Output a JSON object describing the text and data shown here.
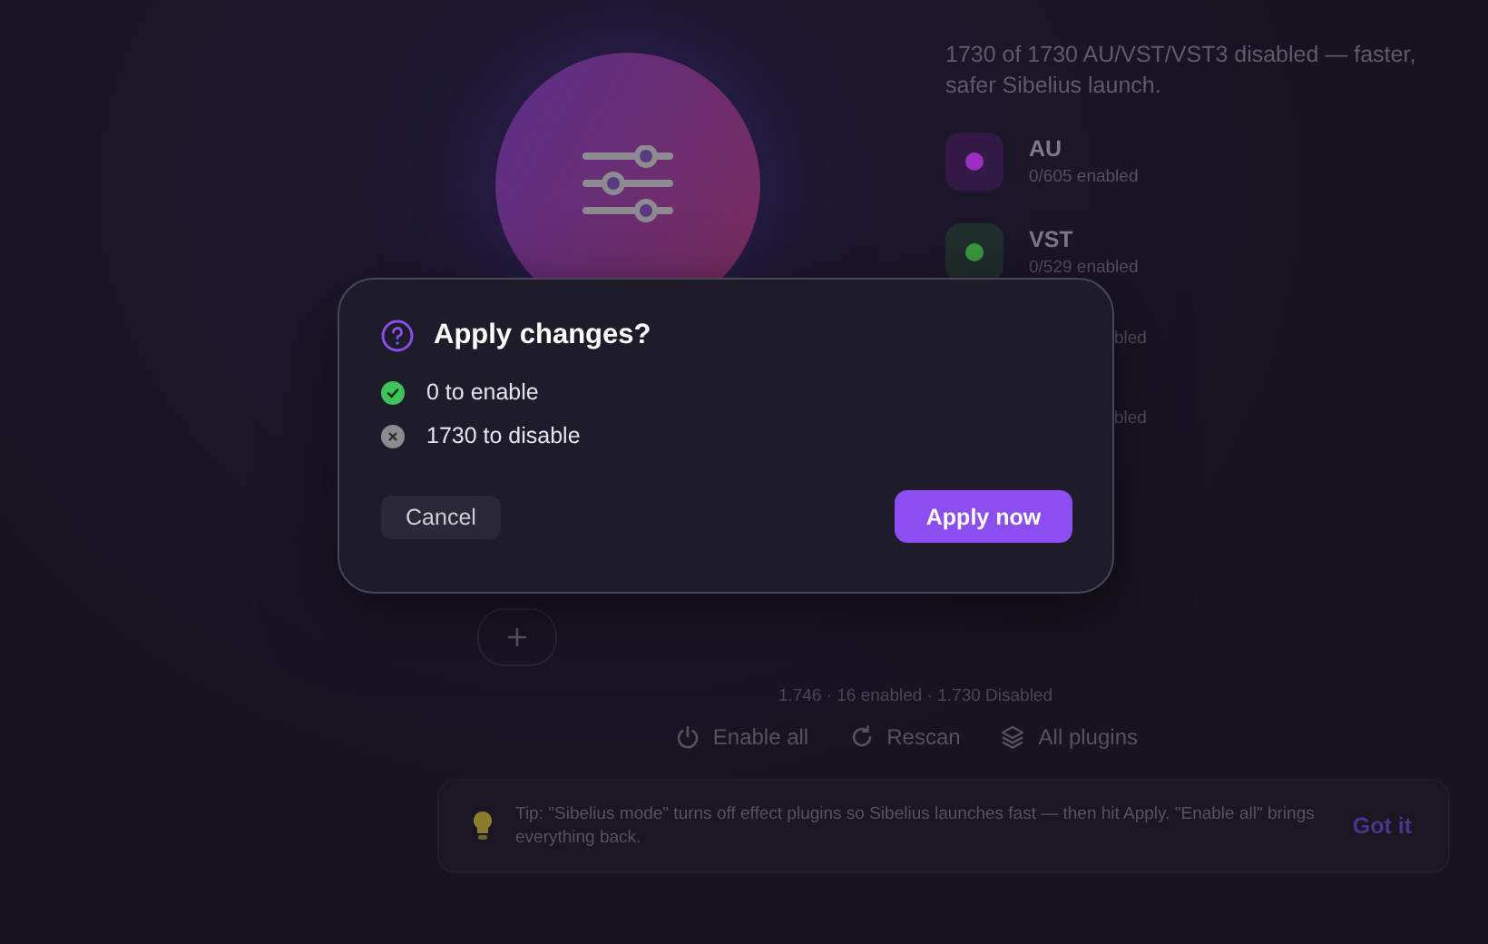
{
  "summary": "1730 of 1730 AU/VST/VST3 disabled — faster, safer Sibelius launch.",
  "plugin_types": [
    {
      "kind": "full",
      "name": "AU",
      "status": "0/605 enabled",
      "color": "#9a2fc0"
    },
    {
      "kind": "full",
      "name": "VST",
      "status": "0/529 enabled",
      "color": "#3a9a3e"
    },
    {
      "kind": "partial",
      "status": "bled"
    },
    {
      "kind": "partial",
      "status": "bled"
    }
  ],
  "stats": "1.746 · 16 enabled · 1.730 Disabled",
  "actions": [
    {
      "kind": "power",
      "label": "Enable all"
    },
    {
      "kind": "rescan",
      "label": "Rescan"
    },
    {
      "kind": "layers",
      "label": "All plugins"
    }
  ],
  "tip": {
    "text": "Tip: \"Sibelius mode\" turns off effect plugins so Sibelius launches fast — then hit Apply. \"Enable all\" brings everything back.",
    "button": "Got it"
  },
  "dialog": {
    "title": "Apply changes?",
    "changes": [
      {
        "kind": "enable",
        "label": "0 to enable"
      },
      {
        "kind": "disable",
        "label": "1730 to disable"
      }
    ],
    "cancel": "Cancel",
    "confirm": "Apply now"
  }
}
